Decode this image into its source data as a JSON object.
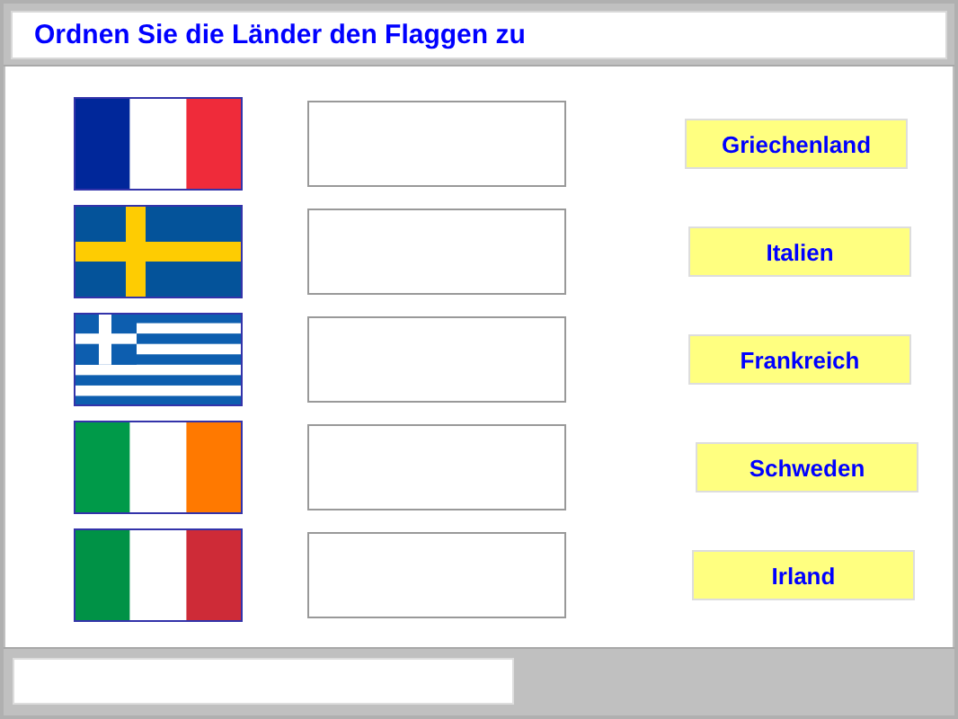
{
  "title": "Ordnen Sie die Länder den Flaggen zu",
  "rows": [
    {
      "flag": {
        "kind": "france"
      },
      "answer": "Griechenland"
    },
    {
      "flag": {
        "kind": "sweden"
      },
      "answer": "Italien"
    },
    {
      "flag": {
        "kind": "greece"
      },
      "answer": "Frankreich"
    },
    {
      "flag": {
        "kind": "ireland"
      },
      "answer": "Schweden"
    },
    {
      "flag": {
        "kind": "italy"
      },
      "answer": "Irland"
    }
  ]
}
